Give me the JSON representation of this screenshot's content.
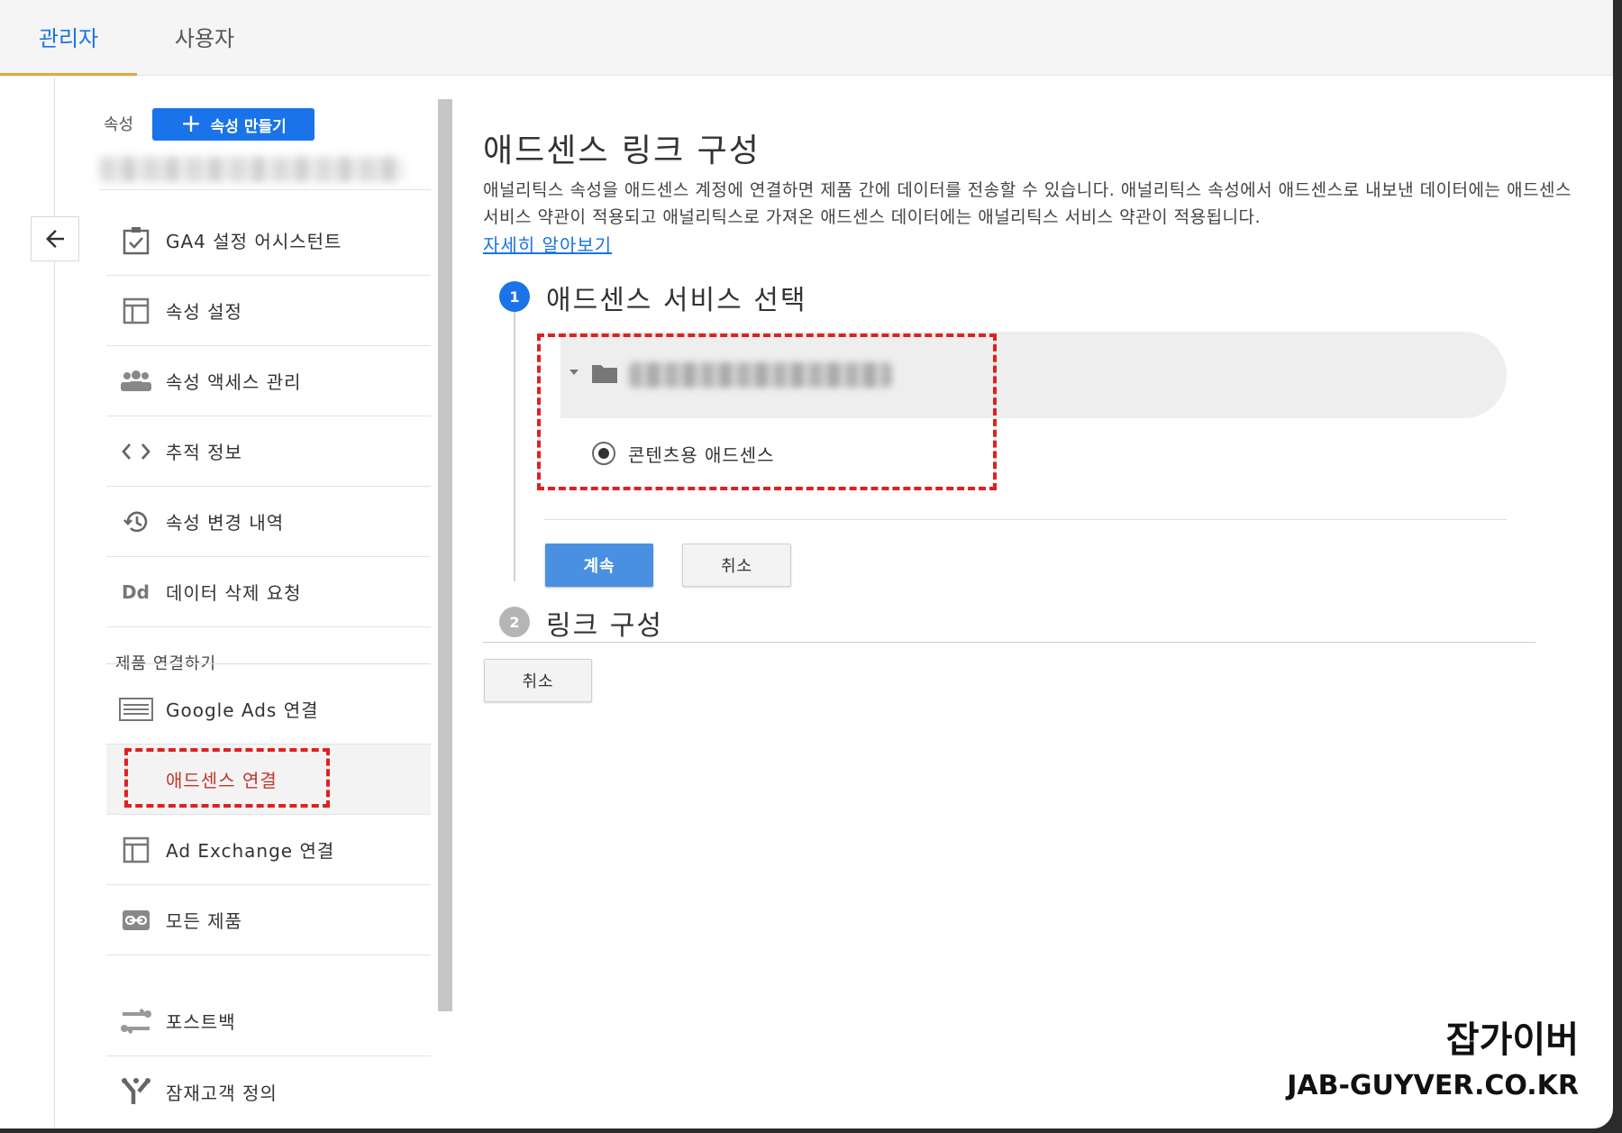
{
  "tabs": [
    {
      "label": "관리자",
      "active": true
    },
    {
      "label": "사용자",
      "active": false
    }
  ],
  "sidebar": {
    "property_label": "속성",
    "create_property_label": "속성 만들기",
    "items": [
      {
        "label": "GA4 설정 어시스턴트",
        "icon": "checklist-icon"
      },
      {
        "label": "속성 설정",
        "icon": "layout-icon"
      },
      {
        "label": "속성 액세스 관리",
        "icon": "people-icon"
      },
      {
        "label": "추적 정보",
        "icon": "code-icon"
      },
      {
        "label": "속성 변경 내역",
        "icon": "history-icon"
      },
      {
        "label": "데이터 삭제 요청",
        "icon": "dd-icon"
      }
    ],
    "section_label": "제품 연결하기",
    "link_items": [
      {
        "label": "Google Ads 연결",
        "icon": "ads-icon"
      },
      {
        "label": "애드센스 연결",
        "icon": "",
        "selected": true
      },
      {
        "label": "Ad Exchange 연결",
        "icon": "layout-icon"
      },
      {
        "label": "모든 제품",
        "icon": "link-icon"
      },
      {
        "label": "포스트백",
        "icon": "postback-icon"
      },
      {
        "label": "잠재고객 정의",
        "icon": "audience-icon"
      }
    ]
  },
  "main": {
    "title": "애드센스 링크 구성",
    "description": "애널리틱스 속성을 애드센스 계정에 연결하면 제품 간에 데이터를 전송할 수 있습니다. 애널리틱스 속성에서 애드센스로 내보낸 데이터에는 애드센스 서비스 약관이 적용되고 애널리틱스로 가져온 애드센스 데이터에는 애널리틱스 서비스 약관이 적용됩니다.",
    "learn_more": "자세히 알아보기",
    "step1": {
      "number": "1",
      "title": "애드센스 서비스 선택",
      "radio_label": "콘텐츠용 애드센스",
      "continue_label": "계속",
      "cancel_label": "취소"
    },
    "step2": {
      "number": "2",
      "title": "링크 구성",
      "cancel_label": "취소"
    }
  },
  "watermark": {
    "line1": "잡가이버",
    "line2": "JAB-GUYVER.CO.KR"
  },
  "colors": {
    "accent": "#1a73e8",
    "primary_button": "#4a90e2",
    "highlight_dash": "#e02020",
    "tab_underline": "#e8a33d"
  }
}
